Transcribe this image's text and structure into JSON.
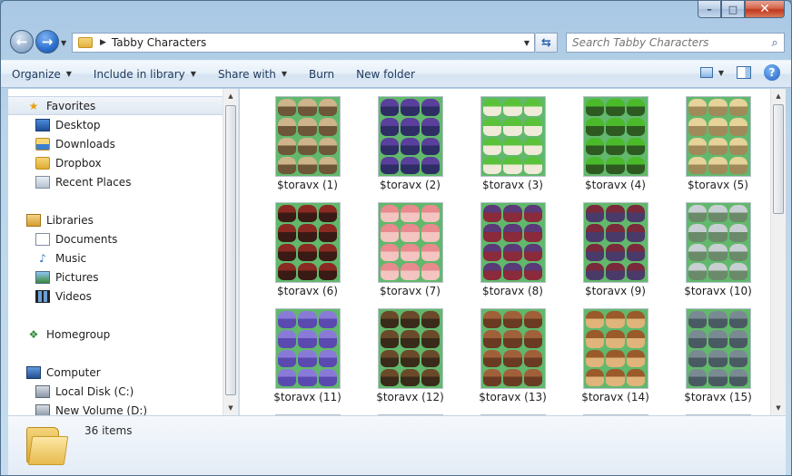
{
  "window": {
    "minimize": "–",
    "maximize": "□",
    "close": "✕"
  },
  "address": {
    "path": "Tabby Characters",
    "search_placeholder": "Search Tabby Characters"
  },
  "toolbar": {
    "organize": "Organize",
    "include_in_library": "Include in library",
    "share_with": "Share with",
    "burn": "Burn",
    "new_folder": "New folder"
  },
  "navigation": {
    "favorites": "Favorites",
    "desktop": "Desktop",
    "downloads": "Downloads",
    "dropbox": "Dropbox",
    "recent_places": "Recent Places",
    "libraries": "Libraries",
    "documents": "Documents",
    "music": "Music",
    "pictures": "Pictures",
    "videos": "Videos",
    "homegroup": "Homegroup",
    "computer": "Computer",
    "local_disk": "Local Disk (C:)",
    "new_volume": "New Volume (D:)"
  },
  "files": [
    {
      "name": "$toravx (1)",
      "palette": [
        "#cdb48a",
        "#6e5638"
      ]
    },
    {
      "name": "$toravx (2)",
      "palette": [
        "#5a3f9c",
        "#2f2d66"
      ]
    },
    {
      "name": "$toravx (3)",
      "palette": [
        "#59c23a",
        "#f0ead8"
      ]
    },
    {
      "name": "$toravx (4)",
      "palette": [
        "#4aba2a",
        "#2e5a22"
      ]
    },
    {
      "name": "$toravx (5)",
      "palette": [
        "#e6d39a",
        "#a08a5a"
      ]
    },
    {
      "name": "$toravx (6)",
      "palette": [
        "#8a2a22",
        "#3a1a14"
      ]
    },
    {
      "name": "$toravx (7)",
      "palette": [
        "#e88a8e",
        "#f3c4c0"
      ]
    },
    {
      "name": "$toravx (8)",
      "palette": [
        "#5a3a78",
        "#8a2a3a"
      ]
    },
    {
      "name": "$toravx (9)",
      "palette": [
        "#7a2a3a",
        "#4a3a6a"
      ]
    },
    {
      "name": "$toravx (10)",
      "palette": [
        "#c8cfd2",
        "#6a8a6a"
      ]
    },
    {
      "name": "$toravx (11)",
      "palette": [
        "#8a7ad8",
        "#5a4ab0"
      ]
    },
    {
      "name": "$toravx (12)",
      "palette": [
        "#6a4a2a",
        "#3a2a1a"
      ]
    },
    {
      "name": "$toravx (13)",
      "palette": [
        "#a0603a",
        "#6a3a22"
      ]
    },
    {
      "name": "$toravx (14)",
      "palette": [
        "#9a5a2a",
        "#e0b47a"
      ]
    },
    {
      "name": "$toravx (15)",
      "palette": [
        "#7a8a92",
        "#4a5a62"
      ]
    }
  ],
  "status": {
    "item_count": "36 items"
  }
}
